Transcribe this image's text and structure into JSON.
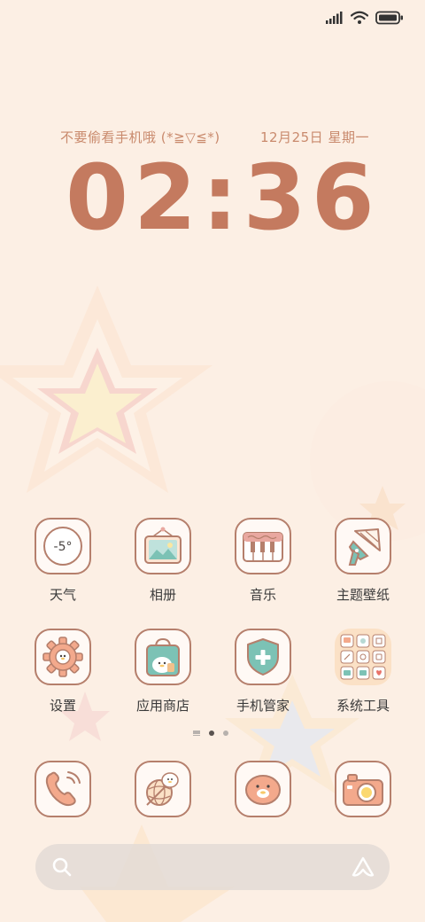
{
  "status_bar": {
    "signal": "signal-icon",
    "wifi": "wifi-icon",
    "battery": "battery-icon"
  },
  "clock_widget": {
    "slogan": "不要偷看手机哦 (*≧▽≦*)",
    "date": "12月25日 星期一",
    "time": "02:36"
  },
  "weather": {
    "temperature": "-5°"
  },
  "apps_row1": [
    {
      "label": "天气",
      "icon": "weather-icon"
    },
    {
      "label": "相册",
      "icon": "gallery-icon"
    },
    {
      "label": "音乐",
      "icon": "music-piano-icon"
    },
    {
      "label": "主题壁纸",
      "icon": "themes-brush-icon"
    }
  ],
  "apps_row2": [
    {
      "label": "设置",
      "icon": "settings-gear-icon"
    },
    {
      "label": "应用商店",
      "icon": "app-store-bag-icon"
    },
    {
      "label": "手机管家",
      "icon": "security-shield-icon"
    },
    {
      "label": "系统工具",
      "icon": "system-tools-folder-icon"
    }
  ],
  "dock": [
    {
      "icon": "phone-icon"
    },
    {
      "icon": "browser-icon"
    },
    {
      "icon": "messages-icon"
    },
    {
      "icon": "camera-icon"
    }
  ],
  "search": {
    "left_icon": "search-icon",
    "right_icon": "assistant-icon"
  },
  "colors": {
    "accent": "#c47a5f",
    "icon_border": "#b57f6c",
    "background": "#fcefe4"
  }
}
